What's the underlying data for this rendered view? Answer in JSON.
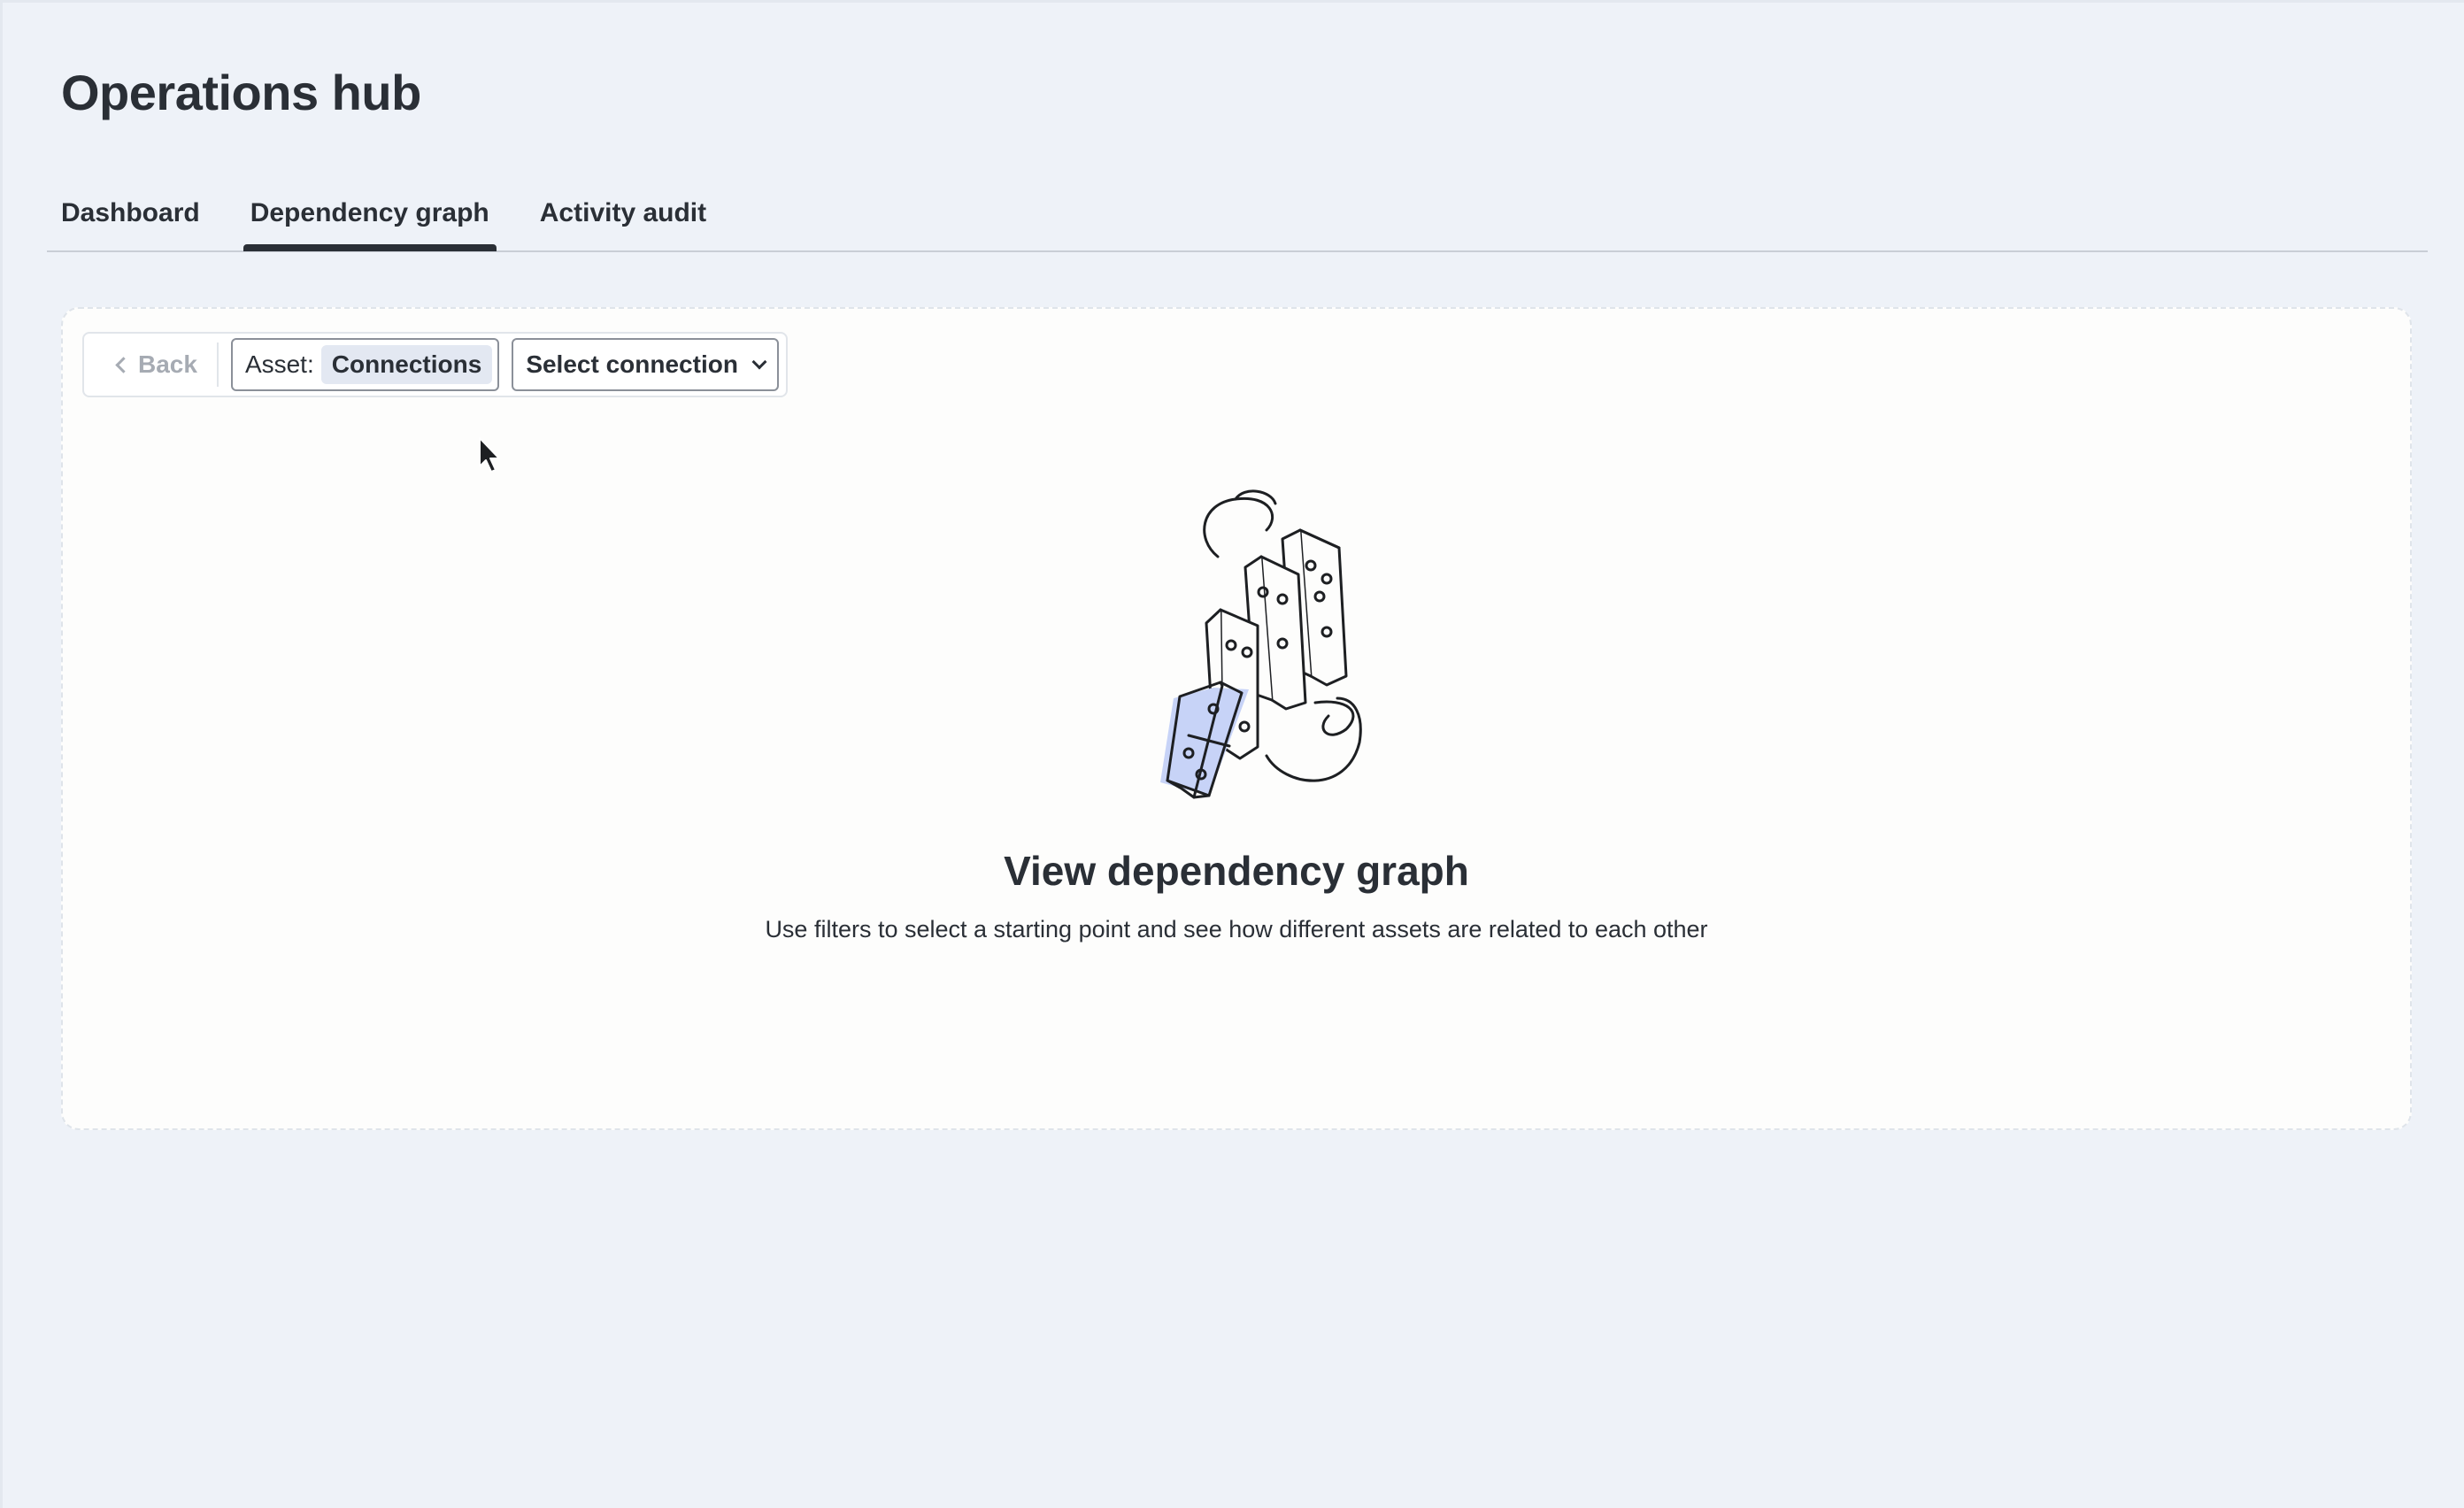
{
  "header": {
    "title": "Operations hub"
  },
  "tabs": [
    {
      "label": "Dashboard",
      "active": false
    },
    {
      "label": "Dependency graph",
      "active": true
    },
    {
      "label": "Activity audit",
      "active": false
    }
  ],
  "toolbar": {
    "back_label": "Back",
    "asset_label": "Asset:",
    "asset_value": "Connections",
    "select_label": "Select connection"
  },
  "empty_state": {
    "title": "View dependency graph",
    "description": "Use filters to select a starting point and see how different assets are related to each other"
  },
  "colors": {
    "background": "#eef2f8",
    "panel": "#fdfdfc",
    "text": "#2a2f36",
    "accent_fill": "#c7d3f7",
    "muted": "#a6abb3"
  },
  "icons": {
    "back": "chevron-left-icon",
    "select": "chevron-down-icon",
    "illustration": "domino-illustration-icon"
  }
}
